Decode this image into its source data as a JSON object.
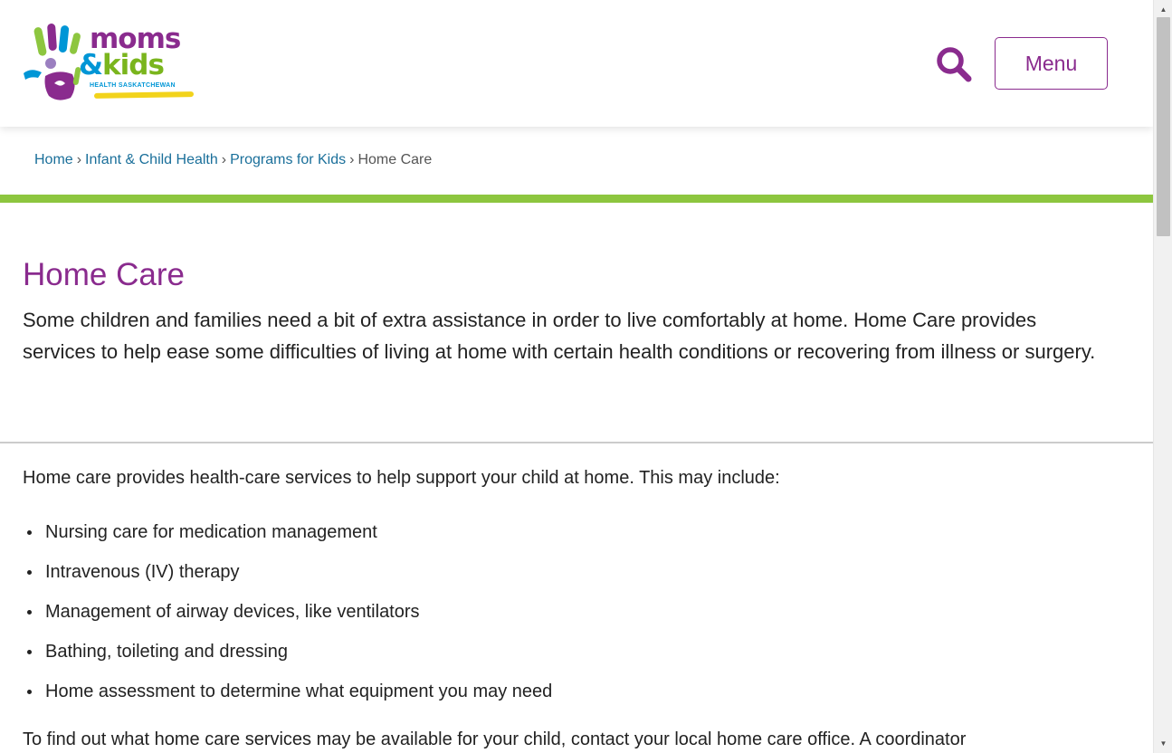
{
  "header": {
    "logo": {
      "line1": "moms",
      "amp": "&",
      "line2": "kids",
      "subtitle": "HEALTH SASKATCHEWAN"
    },
    "search_icon": "search-icon",
    "menu_label": "Menu"
  },
  "breadcrumb": {
    "items": [
      {
        "label": "Home"
      },
      {
        "label": "Infant & Child Health"
      },
      {
        "label": "Programs for Kids"
      }
    ],
    "separator": "›",
    "current": "Home Care"
  },
  "main": {
    "title": "Home Care",
    "intro": "Some children and families need a bit of extra assistance in order to live comfortably at home. Home Care provides services to help ease some difficulties of living at home with certain health conditions or recovering from illness or surgery.",
    "lead": "Home care provides health-care services to help support your child at home. This may include:",
    "list": [
      "Nursing care for medication management",
      "Intravenous (IV) therapy",
      "Management of airway devices, like ventilators",
      "Bathing, toileting and dressing",
      "Home assessment to determine what equipment you may need"
    ],
    "tail": "To find out what home care services may be available for your child, contact your local home care office. A coordinator"
  },
  "colors": {
    "brand_purple": "#8a2b8e",
    "brand_green": "#8dc63f",
    "link_blue": "#1a6f9a"
  }
}
